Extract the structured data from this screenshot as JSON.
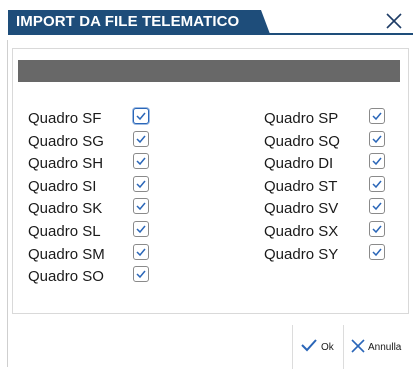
{
  "dialog": {
    "title": "IMPORT DA FILE TELEMATICO",
    "title_color": "#1e4d7a",
    "progress_color": "#686868"
  },
  "items_left": [
    {
      "label": "Quadro SF",
      "checked": true
    },
    {
      "label": "Quadro SG",
      "checked": true
    },
    {
      "label": "Quadro SH",
      "checked": true
    },
    {
      "label": "Quadro SI",
      "checked": true
    },
    {
      "label": "Quadro SK",
      "checked": true
    },
    {
      "label": "Quadro SL",
      "checked": true
    },
    {
      "label": "Quadro SM",
      "checked": true
    },
    {
      "label": "Quadro SO",
      "checked": true
    }
  ],
  "items_right": [
    {
      "label": "Quadro SP",
      "checked": true
    },
    {
      "label": "Quadro SQ",
      "checked": true
    },
    {
      "label": "Quadro DI",
      "checked": true
    },
    {
      "label": "Quadro ST",
      "checked": true
    },
    {
      "label": "Quadro SV",
      "checked": true
    },
    {
      "label": "Quadro SX",
      "checked": true
    },
    {
      "label": "Quadro SY",
      "checked": true
    }
  ],
  "footer": {
    "ok_label": "Ok",
    "cancel_label": "Annulla",
    "ok_icon": "checkmark-icon",
    "cancel_icon": "x-icon"
  }
}
